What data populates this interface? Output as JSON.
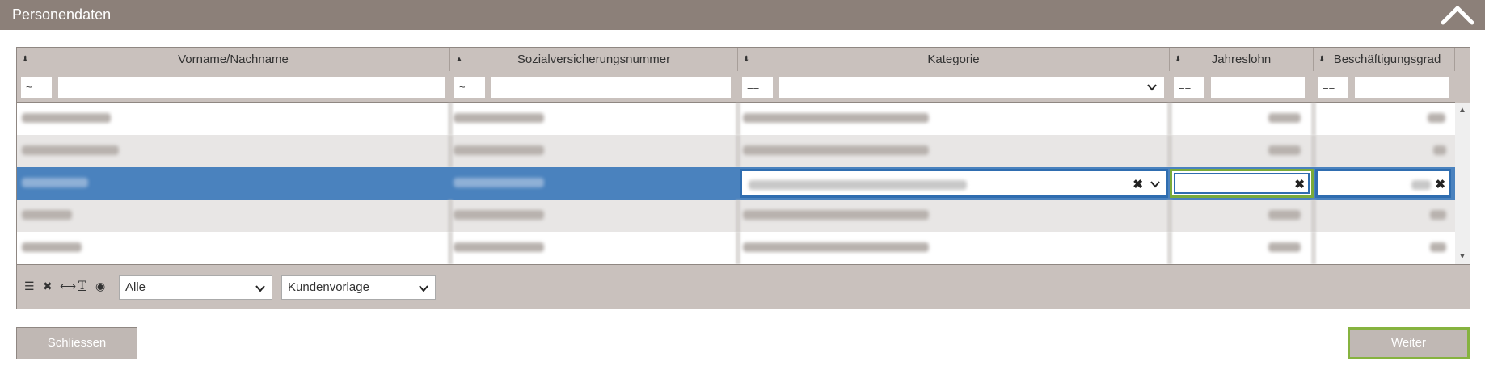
{
  "panel": {
    "title": "Personendaten"
  },
  "table": {
    "columns": [
      {
        "label": "Vorname/Nachname"
      },
      {
        "label": "Sozialversicherungsnummer"
      },
      {
        "label": "Kategorie"
      },
      {
        "label": "Jahreslohn"
      },
      {
        "label": "Beschäftigungsgrad"
      }
    ],
    "filters": {
      "name_op": "~",
      "svnr_op": "~",
      "kategorie_op": "==",
      "lohn_op": "==",
      "grad_op": "=="
    }
  },
  "footer": {
    "filter_select": "Alle",
    "template_select": "Kundenvorlage"
  },
  "buttons": {
    "close": "Schliessen",
    "next": "Weiter"
  },
  "colors": {
    "header_bg": "#8c8079",
    "selected_row": "#4a82be",
    "next_border": "#86b33f"
  },
  "icons": [
    "chevron-up-icon",
    "sort-icon",
    "sort-asc-icon",
    "close-icon",
    "chevron-down-icon",
    "list-icon",
    "expand-icon",
    "text-icon",
    "eye-icon"
  ]
}
